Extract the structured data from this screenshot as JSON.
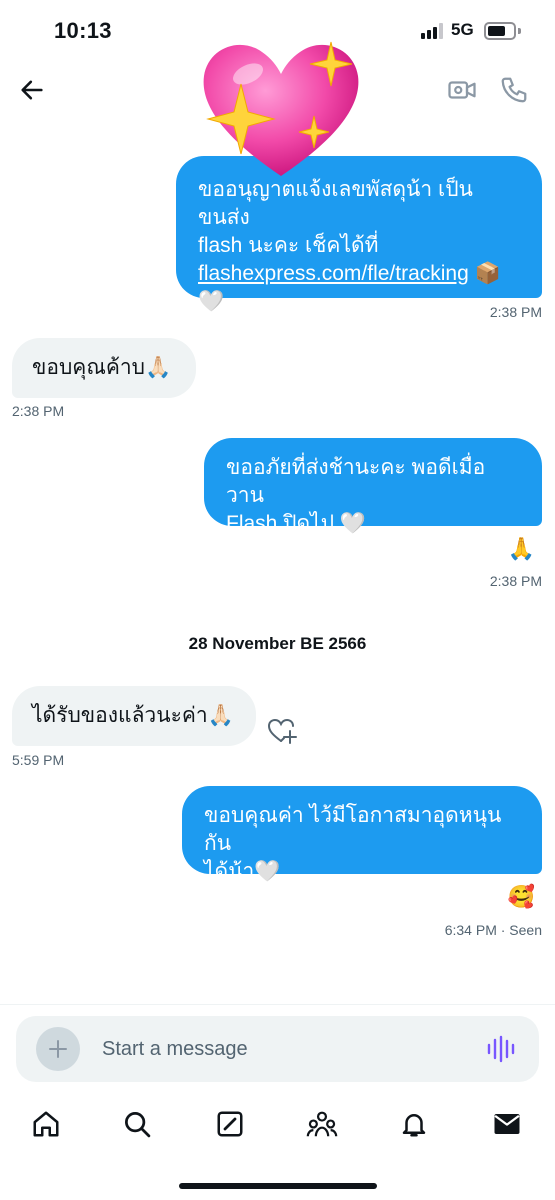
{
  "status_bar": {
    "time": "10:13",
    "network": "5G"
  },
  "header": {
    "back_icon": "arrow-left-icon",
    "video_icon": "video-call-icon",
    "call_icon": "phone-icon"
  },
  "sticker": {
    "icon": "sparkling-heart-sticker",
    "colors": {
      "heart": "#f24aa9",
      "sparkle": "#ffd43b"
    }
  },
  "colors": {
    "outgoing_bubble": "#1d9bf0",
    "incoming_bubble": "#eff3f4",
    "muted_text": "#536471",
    "voice_icon": "#7856ff"
  },
  "messages": [
    {
      "direction": "outgoing",
      "line1": "ขออนุญาตแจ้งเลขพัสดุน้า เป็นขนส่ง",
      "line2": "flash นะคะ เช็คได้ที่",
      "link": "flashexpress.com/fle/tracking",
      "link_suffix": " 📦",
      "line4": "🤍",
      "time": "2:38 PM"
    },
    {
      "direction": "incoming",
      "text": "ขอบคุณค้าบ🙏🏻",
      "time": "2:38 PM"
    },
    {
      "direction": "outgoing",
      "text": "ขออภัยที่ส่งช้านะคะ พอดีเมื่อวาน\nFlash ปิดไป 🤍",
      "reaction": "🙏",
      "time": "2:38 PM"
    },
    {
      "direction": "incoming",
      "text": "ได้รับของแล้วนะค่า🙏🏻",
      "time": "5:59 PM",
      "react_icon": "heart-plus-icon"
    },
    {
      "direction": "outgoing",
      "text": "ขอบคุณค่า ไว้มีโอกาสมาอุดหนุนกัน\nได้น้า🤍",
      "reaction": "🥰",
      "time": "6:34 PM",
      "status": " · Seen"
    }
  ],
  "date_separator": "28 November BE 2566",
  "composer": {
    "placeholder": "Start a message",
    "add_icon": "plus-icon",
    "voice_icon": "voice-waveform-icon"
  },
  "tabs": [
    {
      "icon": "home-icon"
    },
    {
      "icon": "search-icon"
    },
    {
      "icon": "compose-icon"
    },
    {
      "icon": "communities-icon"
    },
    {
      "icon": "notifications-bell-icon"
    },
    {
      "icon": "messages-envelope-icon"
    }
  ]
}
